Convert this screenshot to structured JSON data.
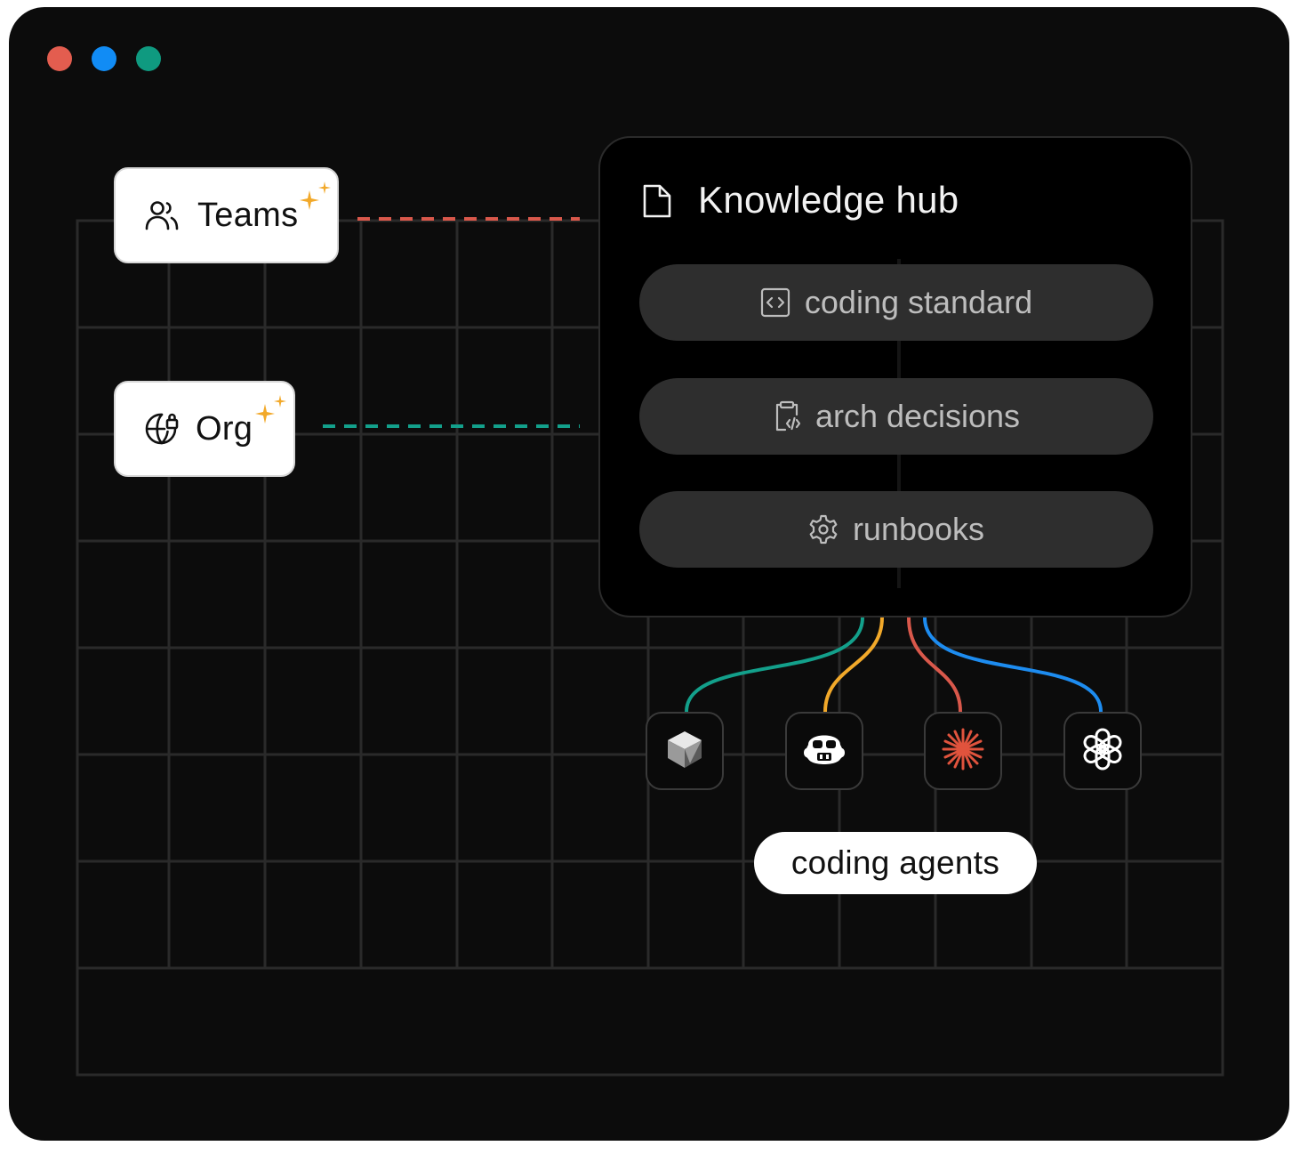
{
  "window": {
    "controls": [
      {
        "name": "close",
        "color": "#e35d4f"
      },
      {
        "name": "expand",
        "color": "#118cf5"
      },
      {
        "name": "minimize",
        "color": "#0f9a80"
      }
    ]
  },
  "sources": {
    "teams": {
      "label": "Teams",
      "icon": "users-icon",
      "connector_color": "#d9584b"
    },
    "org": {
      "label": "Org",
      "icon": "globe-lock-icon",
      "connector_color": "#13a08b"
    }
  },
  "hub": {
    "title": "Knowledge hub",
    "icon": "document-icon",
    "items": [
      {
        "label": "coding standard",
        "icon": "code-icon"
      },
      {
        "label": "arch decisions",
        "icon": "clipboard-code-icon"
      },
      {
        "label": "runbooks",
        "icon": "gear-icon"
      }
    ]
  },
  "agents": {
    "label": "coding agents",
    "items": [
      {
        "icon": "cube-icon",
        "wire_color": "#13a08b"
      },
      {
        "icon": "robot-icon",
        "wire_color": "#f2a92a"
      },
      {
        "icon": "starburst-icon",
        "wire_color": "#d9584b"
      },
      {
        "icon": "openai-knot-icon",
        "wire_color": "#1d8cf0"
      }
    ]
  },
  "colors": {
    "background": "#0c0c0c",
    "grid": "#2a2a2a",
    "sparkle": "#f2a92a",
    "pill": "#2e2e2e"
  }
}
